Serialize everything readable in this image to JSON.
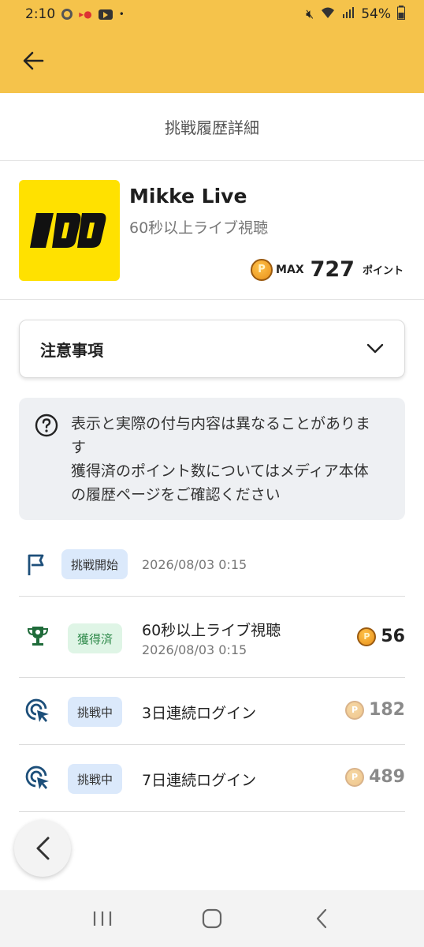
{
  "status": {
    "time": "2:10",
    "battery": "54%",
    "icons": [
      "chrome-icon",
      "app-icon",
      "youtube-icon",
      "mute-icon",
      "wifi-icon",
      "signal-icon",
      "battery-icon"
    ]
  },
  "header": {
    "title": "挑戦履歴詳細"
  },
  "app": {
    "name": "Mikke Live",
    "subtitle": "60秒以上ライブ視聴",
    "max_label": "MAX",
    "max_value": "727",
    "max_unit": "ポイント"
  },
  "notice": {
    "label": "注意事項"
  },
  "info": {
    "lines": [
      "表示と実際の付与内容は異なることがありま",
      "す",
      "獲得済のポイント数についてはメディア本体",
      "の履歴ページをご確認ください"
    ]
  },
  "history": [
    {
      "badge": "挑戦開始",
      "date": "2026/08/03 0:15"
    },
    {
      "badge": "獲得済",
      "title": "60秒以上ライブ視聴",
      "date": "2026/08/03 0:15",
      "points": "56"
    },
    {
      "badge": "挑戦中",
      "title": "3日連続ログイン",
      "points": "182"
    },
    {
      "badge": "挑戦中",
      "title": "7日連続ログイン",
      "points": "489"
    }
  ],
  "colors": {
    "accent": "#f5c34b",
    "logo_bg": "#ffe100",
    "done_green": "#2f8a4b",
    "icon_blue": "#1d4f7a",
    "icon_green": "#1f6b3a"
  }
}
